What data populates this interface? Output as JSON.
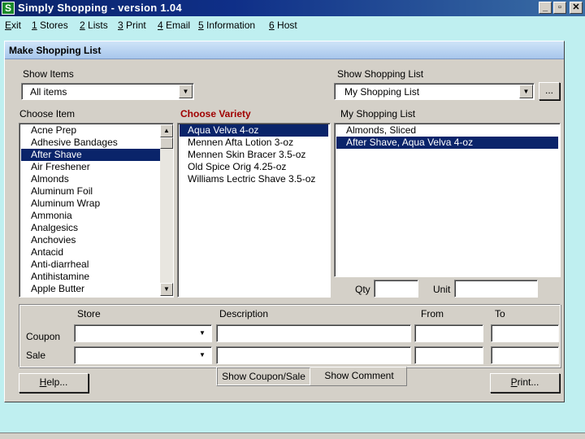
{
  "window": {
    "icon_glyph": "S",
    "title": "Simply Shopping  -  version 1.04",
    "minimize": "_",
    "maximize": "▫",
    "close": "✕"
  },
  "menu": [
    {
      "key": "E",
      "rest": "xit"
    },
    {
      "key": "1",
      "rest": " Stores"
    },
    {
      "key": "2",
      "rest": " Lists"
    },
    {
      "key": "3",
      "rest": " Print"
    },
    {
      "key": "4",
      "rest": " Email"
    },
    {
      "key": "5",
      "rest": " Information"
    },
    {
      "key": "6",
      "rest": " Host"
    }
  ],
  "panel": {
    "title": "Make Shopping List",
    "show_items": {
      "label": "Show Items",
      "value": "All items"
    },
    "show_list": {
      "label": "Show Shopping List",
      "value": "My Shopping List",
      "browse": "..."
    },
    "choose_item": {
      "label": "Choose Item",
      "items": [
        "Acne Prep",
        "Adhesive Bandages",
        "After Shave",
        "Air Freshener",
        "Almonds",
        "Aluminum Foil",
        "Aluminum Wrap",
        "Ammonia",
        "Analgesics",
        "Anchovies",
        "Antacid",
        "Anti-diarrheal",
        "Antihistamine",
        "Apple Butter"
      ],
      "selected_index": 2
    },
    "choose_variety": {
      "label": "Choose Variety",
      "items": [
        "Aqua Velva 4-oz",
        "Mennen Afta Lotion 3-oz",
        "Mennen Skin Bracer 3.5-oz",
        "Old Spice Orig 4.25-oz",
        "Williams Lectric Shave 3.5-oz"
      ],
      "selected_index": 0
    },
    "my_list": {
      "label": "My Shopping List",
      "items": [
        "Almonds, Sliced",
        "After Shave, Aqua Velva 4-oz"
      ],
      "selected_index": 1
    },
    "qty": {
      "label": "Qty",
      "value": ""
    },
    "unit": {
      "label": "Unit",
      "value": ""
    },
    "coupon_sale": {
      "headers": {
        "store": "Store",
        "description": "Description",
        "from": "From",
        "to": "To"
      },
      "rows": [
        {
          "label": "Coupon",
          "store": "",
          "description": "",
          "from": "",
          "to": ""
        },
        {
          "label": "Sale",
          "store": "",
          "description": "",
          "from": "",
          "to": ""
        }
      ]
    },
    "buttons": {
      "help_key": "H",
      "help_rest": "elp...",
      "show_coupon": "Show Coupon/Sale",
      "show_comment": "Show Comment",
      "print_key": "P",
      "print_rest": "rint..."
    }
  }
}
